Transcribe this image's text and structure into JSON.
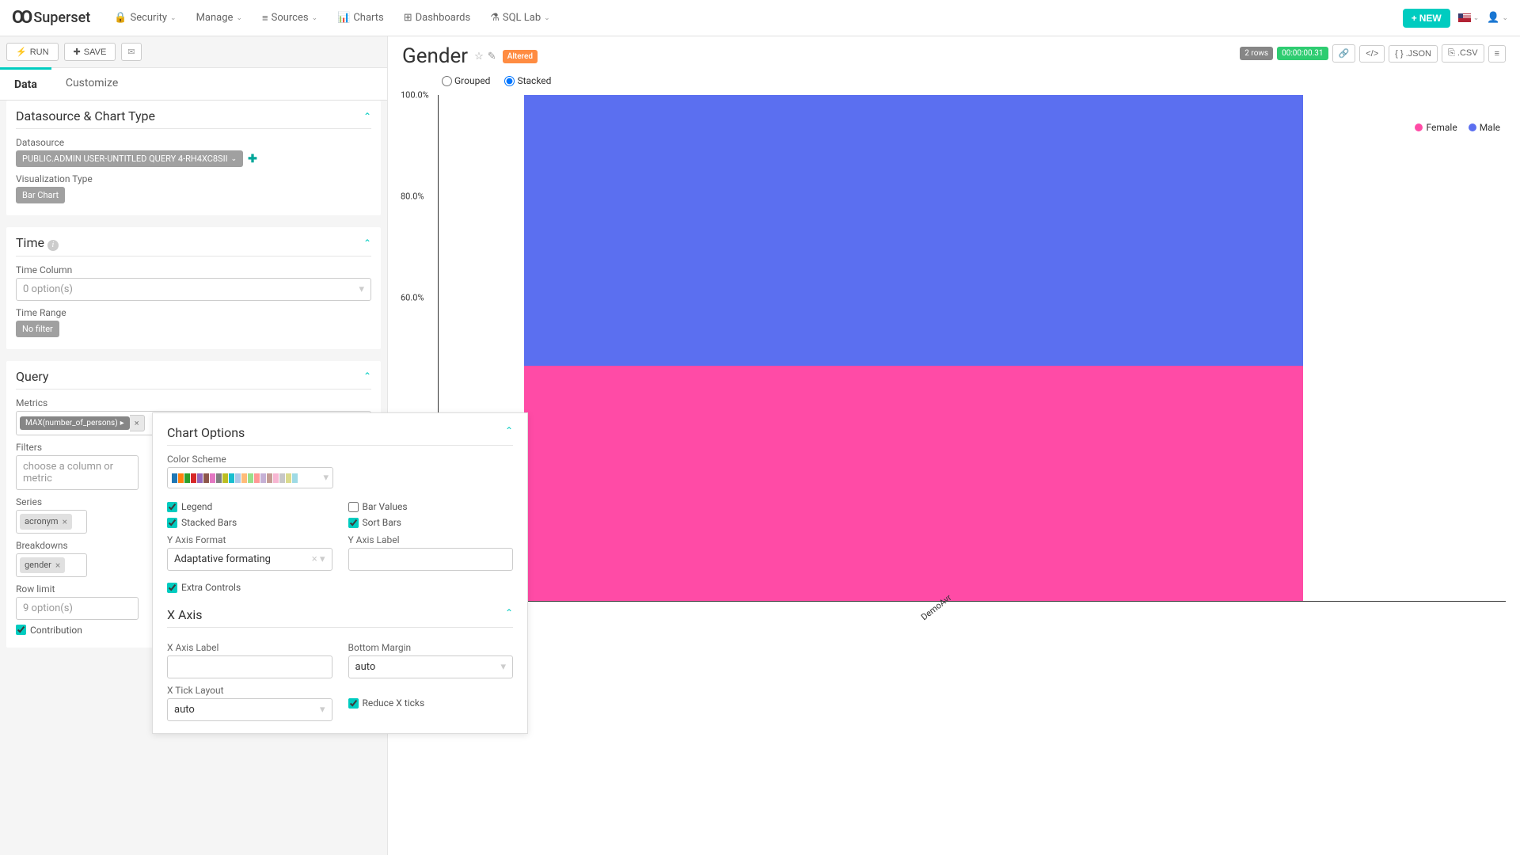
{
  "nav": {
    "brand": "Superset",
    "items": [
      "Security",
      "Manage",
      "Sources",
      "Charts",
      "Dashboards",
      "SQL Lab"
    ],
    "new_label": "NEW"
  },
  "toolbar": {
    "run": "RUN",
    "save": "SAVE"
  },
  "tabs": {
    "data": "Data",
    "customize": "Customize"
  },
  "datasource_section": {
    "title": "Datasource & Chart Type",
    "datasource_label": "Datasource",
    "datasource_value": "PUBLIC.ADMIN USER-UNTITLED QUERY 4-RH4XC8SII",
    "viz_label": "Visualization Type",
    "viz_value": "Bar Chart"
  },
  "time_section": {
    "title": "Time",
    "time_column_label": "Time Column",
    "time_column_value": "0 option(s)",
    "time_range_label": "Time Range",
    "time_range_value": "No filter"
  },
  "query_section": {
    "title": "Query",
    "metrics_label": "Metrics",
    "metrics_value": "MAX(number_of_persons)",
    "filters_label": "Filters",
    "filters_placeholder": "choose a column or metric",
    "series_label": "Series",
    "series_value": "acronym",
    "breakdowns_label": "Breakdowns",
    "breakdowns_value": "gender",
    "rowlimit_label": "Row limit",
    "rowlimit_value": "9 option(s)",
    "contribution_label": "Contribution"
  },
  "chart_options": {
    "title": "Chart Options",
    "color_scheme_label": "Color Scheme",
    "legend_label": "Legend",
    "bar_values_label": "Bar Values",
    "stacked_bars_label": "Stacked Bars",
    "sort_bars_label": "Sort Bars",
    "yaxis_format_label": "Y Axis Format",
    "yaxis_format_value": "Adaptative formating",
    "yaxis_label_label": "Y Axis Label",
    "extra_controls_label": "Extra Controls",
    "xaxis_title": "X Axis",
    "xaxis_label_label": "X Axis Label",
    "bottom_margin_label": "Bottom Margin",
    "bottom_margin_value": "auto",
    "xtick_layout_label": "X Tick Layout",
    "xtick_layout_value": "auto",
    "reduce_x_label": "Reduce X ticks",
    "swatch_colors": [
      "#1f77b4",
      "#ff7f0e",
      "#2ca02c",
      "#d62728",
      "#9467bd",
      "#8c564b",
      "#e377c2",
      "#7f7f7f",
      "#bcbd22",
      "#17becf",
      "#aec7e8",
      "#ffbb78",
      "#98df8a",
      "#ff9896",
      "#c5b0d5",
      "#c49c94",
      "#f7b6d2",
      "#c7c7c7",
      "#dbdb8d",
      "#9edae5"
    ]
  },
  "chart_header": {
    "title": "Gender",
    "altered": "Altered",
    "rows": "2 rows",
    "timing": "00:00:00.31",
    "json": ".JSON",
    "csv": ".CSV"
  },
  "chart_controls": {
    "grouped": "Grouped",
    "stacked": "Stacked"
  },
  "legend": {
    "female": "Female",
    "male": "Male",
    "female_color": "#ff4ba6",
    "male_color": "#5b6ff0"
  },
  "chart_data": {
    "type": "bar",
    "stacked": true,
    "normalized_percent": true,
    "categories": [
      "DemoAvr"
    ],
    "series": [
      {
        "name": "Female",
        "color": "#ff4ba6",
        "values": [
          46.5
        ]
      },
      {
        "name": "Male",
        "color": "#5b6ff0",
        "values": [
          53.5
        ]
      }
    ],
    "ylim": [
      0,
      100
    ],
    "yticks": [
      100.0,
      80.0,
      60.0
    ],
    "ytick_labels": [
      "100.0%",
      "80.0%",
      "60.0%"
    ],
    "ylabel": "",
    "xlabel": "",
    "title": "Gender"
  }
}
